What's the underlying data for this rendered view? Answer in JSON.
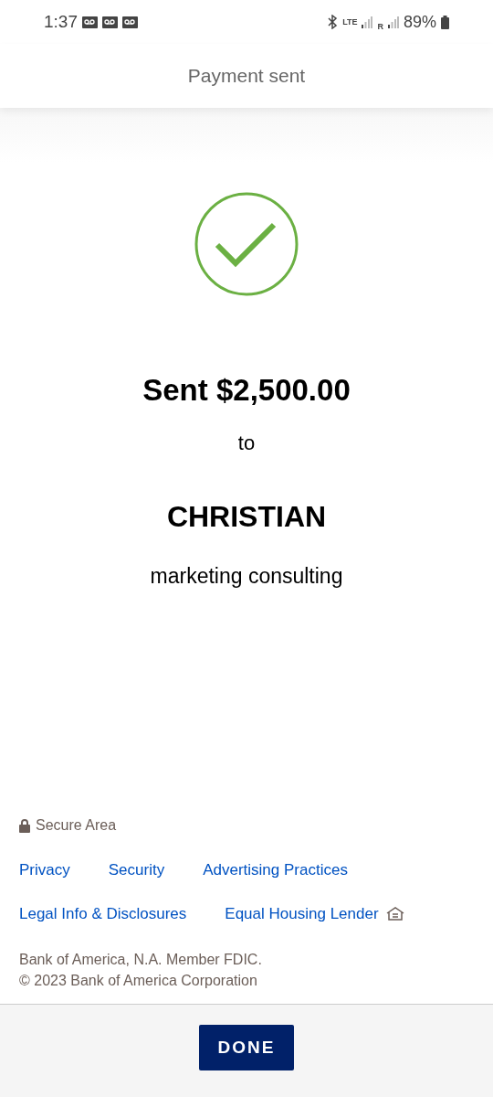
{
  "status_bar": {
    "time": "1:37",
    "network": "LTE",
    "roaming": "R",
    "battery": "89%"
  },
  "header": {
    "title": "Payment sent"
  },
  "confirmation": {
    "amount": "Sent $2,500.00",
    "connector": "to",
    "recipient": "CHRISTIAN",
    "memo": "marketing consulting"
  },
  "footer": {
    "secure_label": "Secure Area",
    "links": [
      [
        "Privacy",
        "Security",
        "Advertising Practices"
      ],
      [
        "Legal Info & Disclosures",
        "Equal Housing Lender"
      ]
    ],
    "legal": [
      "Bank of America, N.A. Member FDIC.",
      "© 2023 Bank of America Corporation"
    ]
  },
  "done_button": "DONE"
}
